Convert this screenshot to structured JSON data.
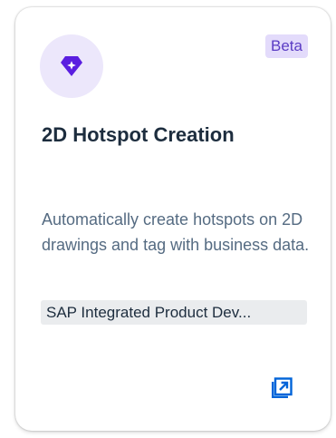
{
  "card": {
    "icon": "diamond-icon",
    "badge": "Beta",
    "title": "2D Hotspot Creation",
    "description": "Automatically create hotspots on 2D drawings and tag with business data.",
    "tag": "SAP Integrated Product Dev...",
    "action_icon": "open-external-icon"
  },
  "colors": {
    "accent": "#5b3cc4",
    "icon_purple": "#5a1ee0",
    "avatar_background": "#ece7fb",
    "badge_background": "#e3dbfb",
    "title_text": "#1d2d3e",
    "description_text": "#556b82",
    "tag_background": "#eaecee",
    "action_icon": "#0064d9"
  }
}
